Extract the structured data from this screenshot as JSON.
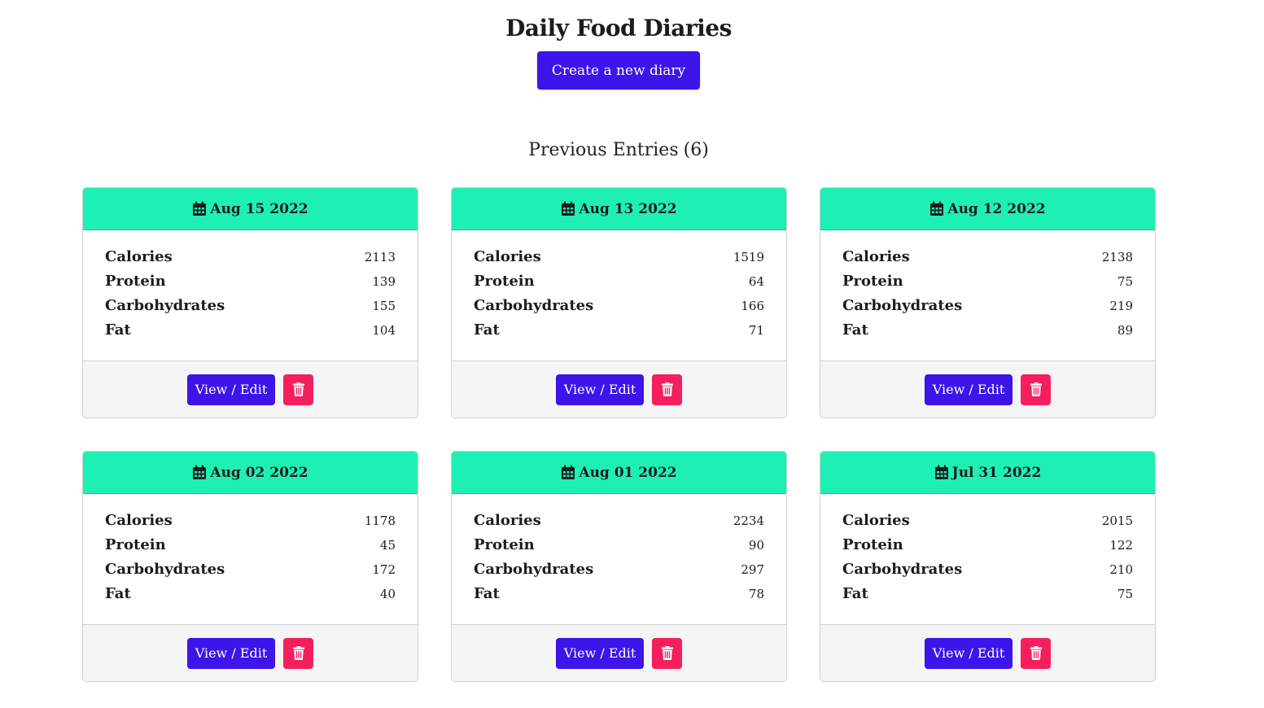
{
  "header": {
    "title": "Daily Food Diaries",
    "create_button": "Create a new diary"
  },
  "entries": {
    "heading": "Previous Entries",
    "count": "(6)",
    "stat_labels": {
      "calories": "Calories",
      "protein": "Protein",
      "carbohydrates": "Carbohydrates",
      "fat": "Fat"
    },
    "view_edit_label": "View / Edit",
    "icons": {
      "date": "calendar-icon",
      "delete": "trash-icon"
    },
    "colors": {
      "card_header": "#1ef0b4",
      "primary_button": "#3d14ea",
      "delete_button": "#f51f5e"
    },
    "items": [
      {
        "date": "Aug 15 2022",
        "calories": "2113",
        "protein": "139",
        "carbohydrates": "155",
        "fat": "104"
      },
      {
        "date": "Aug 13 2022",
        "calories": "1519",
        "protein": "64",
        "carbohydrates": "166",
        "fat": "71"
      },
      {
        "date": "Aug 12 2022",
        "calories": "2138",
        "protein": "75",
        "carbohydrates": "219",
        "fat": "89"
      },
      {
        "date": "Aug 02 2022",
        "calories": "1178",
        "protein": "45",
        "carbohydrates": "172",
        "fat": "40"
      },
      {
        "date": "Aug 01 2022",
        "calories": "2234",
        "protein": "90",
        "carbohydrates": "297",
        "fat": "78"
      },
      {
        "date": "Jul 31 2022",
        "calories": "2015",
        "protein": "122",
        "carbohydrates": "210",
        "fat": "75"
      }
    ]
  }
}
